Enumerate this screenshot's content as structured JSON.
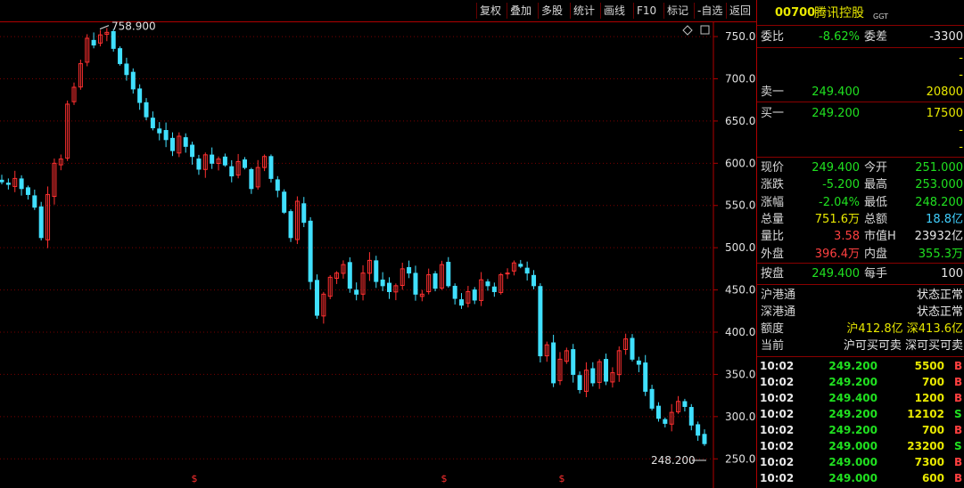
{
  "toolbar": {
    "buttons": [
      "复权",
      "叠加",
      "多股",
      "统计",
      "画线",
      "F10",
      "标记",
      "-自选",
      "返回"
    ]
  },
  "header": {
    "code": "00700",
    "name": "腾讯控股",
    "badge": "GGT"
  },
  "chart_icons": [
    "diamond-icon",
    "square-icon"
  ],
  "chart_data": {
    "type": "candlestick",
    "y_ticks": [
      "750.0",
      "700.0",
      "650.0",
      "600.0",
      "550.0",
      "500.0",
      "450.0",
      "400.0",
      "350.0",
      "300.0",
      "250.0"
    ],
    "ylim": [
      245,
      768
    ],
    "annotations": {
      "high": "758.900",
      "low": "248.200"
    },
    "marker_symbol": "$",
    "closes": [
      578,
      575,
      582,
      570,
      563,
      548,
      512,
      563,
      600,
      605,
      670,
      690,
      718,
      748,
      740,
      752,
      755,
      736,
      718,
      705,
      688,
      672,
      655,
      642,
      636,
      628,
      615,
      632,
      620,
      608,
      593,
      610,
      600,
      605,
      598,
      585,
      602,
      595,
      570,
      595,
      608,
      582,
      568,
      542,
      512,
      555,
      530,
      460,
      420,
      445,
      465,
      470,
      480,
      452,
      445,
      470,
      485,
      460,
      455,
      448,
      455,
      475,
      470,
      445,
      445,
      468,
      452,
      480,
      455,
      440,
      432,
      448,
      438,
      462,
      455,
      448,
      468,
      470,
      482,
      478,
      470,
      455,
      372,
      385,
      340,
      368,
      378,
      350,
      332,
      355,
      340,
      365,
      342,
      352,
      378,
      392,
      368,
      362,
      330,
      310,
      298,
      292,
      305,
      318,
      312,
      290,
      278,
      268
    ],
    "colors": {
      "up": "#ff3030",
      "down": "#40e0ff",
      "grid": "#7a0000",
      "axis_text": "#e0e0e0"
    }
  },
  "quote": {
    "weibi": {
      "label": "委比",
      "value": "-8.62%",
      "label2": "委差",
      "value2": "-3300"
    },
    "sell_rows": [
      {
        "label": "",
        "price": "",
        "vol": "-"
      },
      {
        "label": "",
        "price": "",
        "vol": "-"
      },
      {
        "label": "卖一",
        "price": "249.400",
        "vol": "20800"
      }
    ],
    "buy_rows": [
      {
        "label": "买一",
        "price": "249.200",
        "vol": "17500"
      },
      {
        "label": "",
        "price": "",
        "vol": "-"
      },
      {
        "label": "",
        "price": "",
        "vol": "-"
      }
    ],
    "stats": [
      {
        "l1": "现价",
        "v1": "249.400",
        "c1": "green",
        "l2": "今开",
        "v2": "251.000",
        "c2": "green"
      },
      {
        "l1": "涨跌",
        "v1": "-5.200",
        "c1": "green",
        "l2": "最高",
        "v2": "253.000",
        "c2": "green"
      },
      {
        "l1": "涨幅",
        "v1": "-2.04%",
        "c1": "green",
        "l2": "最低",
        "v2": "248.200",
        "c2": "green"
      },
      {
        "l1": "总量",
        "v1": "751.6万",
        "c1": "yellow",
        "l2": "总额",
        "v2": "18.8亿",
        "c2": "cyan"
      },
      {
        "l1": "量比",
        "v1": "3.58",
        "c1": "red",
        "l2": "市值H",
        "v2": "23932亿",
        "c2": "white"
      },
      {
        "l1": "外盘",
        "v1": "396.4万",
        "c1": "red",
        "l2": "内盘",
        "v2": "355.3万",
        "c2": "green"
      }
    ],
    "auction": {
      "l1": "按盘",
      "v1": "249.400",
      "l2": "每手",
      "v2": "100"
    },
    "connect": [
      {
        "label": "沪港通",
        "value": "状态正常"
      },
      {
        "label": "深港通",
        "value": "状态正常"
      }
    ],
    "quota": {
      "label": "额度",
      "value": "沪412.8亿 深413.6亿"
    },
    "current": {
      "label": "当前",
      "value": "沪可买可卖 深可买可卖"
    }
  },
  "ticks": [
    {
      "time": "10:02",
      "price": "249.200",
      "vol": "5500",
      "side": "B",
      "pc": "green",
      "sc": "red"
    },
    {
      "time": "10:02",
      "price": "249.200",
      "vol": "700",
      "side": "B",
      "pc": "green",
      "sc": "red"
    },
    {
      "time": "10:02",
      "price": "249.400",
      "vol": "1200",
      "side": "B",
      "pc": "green",
      "sc": "red"
    },
    {
      "time": "10:02",
      "price": "249.200",
      "vol": "12102",
      "side": "S",
      "pc": "green",
      "sc": "green"
    },
    {
      "time": "10:02",
      "price": "249.200",
      "vol": "700",
      "side": "B",
      "pc": "green",
      "sc": "red"
    },
    {
      "time": "10:02",
      "price": "249.000",
      "vol": "23200",
      "side": "S",
      "pc": "green",
      "sc": "green"
    },
    {
      "time": "10:02",
      "price": "249.000",
      "vol": "7300",
      "side": "B",
      "pc": "green",
      "sc": "red"
    },
    {
      "time": "10:02",
      "price": "249.000",
      "vol": "600",
      "side": "B",
      "pc": "green",
      "sc": "red"
    }
  ]
}
